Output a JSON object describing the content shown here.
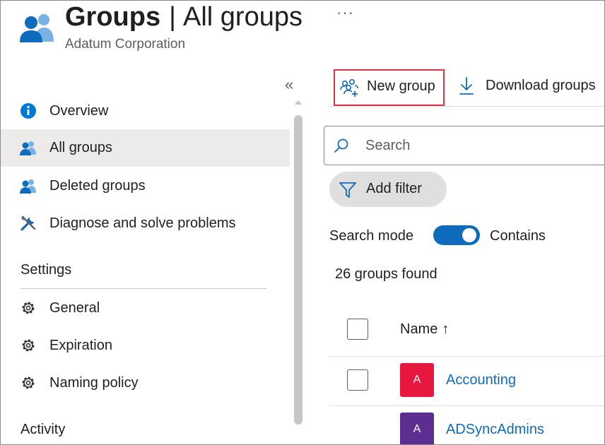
{
  "header": {
    "title_strong": "Groups",
    "title_separator": "|",
    "title_rest": "All groups",
    "subtitle": "Adatum Corporation",
    "more_label": "···",
    "icon": "groups-icon"
  },
  "sidebar": {
    "collapse_label": "«",
    "items": [
      {
        "label": "Overview",
        "icon": "info-icon",
        "active": false
      },
      {
        "label": "All groups",
        "icon": "groups-icon",
        "active": true
      },
      {
        "label": "Deleted groups",
        "icon": "groups-icon",
        "active": false
      },
      {
        "label": "Diagnose and solve problems",
        "icon": "wrench-icon",
        "active": false
      }
    ],
    "settings_header": "Settings",
    "settings_items": [
      {
        "label": "General",
        "icon": "gear-icon"
      },
      {
        "label": "Expiration",
        "icon": "gear-icon"
      },
      {
        "label": "Naming policy",
        "icon": "gear-icon"
      }
    ],
    "activity_header": "Activity"
  },
  "toolbar": {
    "new_group_label": "New group",
    "download_label": "Download groups"
  },
  "search": {
    "placeholder": "Search",
    "value": ""
  },
  "filter": {
    "add_filter_label": "Add filter"
  },
  "search_mode": {
    "label": "Search mode",
    "toggle_on": true,
    "toggle_label": "Contains"
  },
  "results": {
    "count_text": "26 groups found",
    "columns": [
      {
        "label": "Name",
        "sort": "↑"
      }
    ],
    "rows": [
      {
        "initial": "A",
        "name": "Accounting",
        "color": "#e8173f"
      },
      {
        "initial": "A",
        "name": "ADSyncAdmins",
        "color": "#5c2e91"
      }
    ]
  },
  "colors": {
    "accent": "#0f6cbd",
    "highlight_border": "#e0323d",
    "active_nav_bg": "#edebe9",
    "info_icon": "#0078d4"
  }
}
